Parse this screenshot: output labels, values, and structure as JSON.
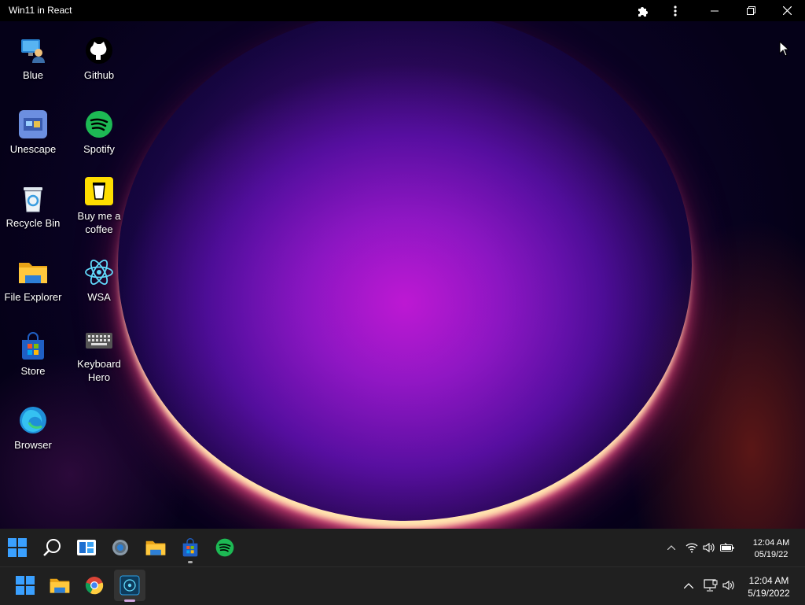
{
  "window": {
    "title": "Win11 in React"
  },
  "desktop_icons": [
    {
      "label": "Blue",
      "icon": "user-monitor-icon"
    },
    {
      "label": "Unescape",
      "icon": "unescape-icon"
    },
    {
      "label": "Recycle Bin",
      "icon": "recycle-bin-icon"
    },
    {
      "label": "File Explorer",
      "icon": "folder-icon"
    },
    {
      "label": "Store",
      "icon": "store-icon"
    },
    {
      "label": "Browser",
      "icon": "edge-icon"
    },
    {
      "label": "Github",
      "icon": "github-icon"
    },
    {
      "label": "Spotify",
      "icon": "spotify-icon"
    },
    {
      "label": "Buy me a coffee",
      "icon": "coffee-icon"
    },
    {
      "label": "WSA",
      "icon": "react-icon"
    },
    {
      "label": "Keyboard Hero",
      "icon": "keyboard-icon"
    }
  ],
  "inner_taskbar": {
    "apps": [
      "start-icon",
      "search-icon",
      "widgets-icon",
      "settings-icon",
      "folder-icon",
      "store-icon",
      "spotify-icon"
    ],
    "time": "12:04 AM",
    "date": "05/19/22"
  },
  "host_taskbar": {
    "apps": [
      "start-icon",
      "folder-icon",
      "chrome-icon",
      "app-icon"
    ],
    "time": "12:04 AM",
    "date": "5/19/2022"
  },
  "colors": {
    "accent": "#0078d4",
    "spotify": "#1db954",
    "coffee": "#ffdd00"
  }
}
